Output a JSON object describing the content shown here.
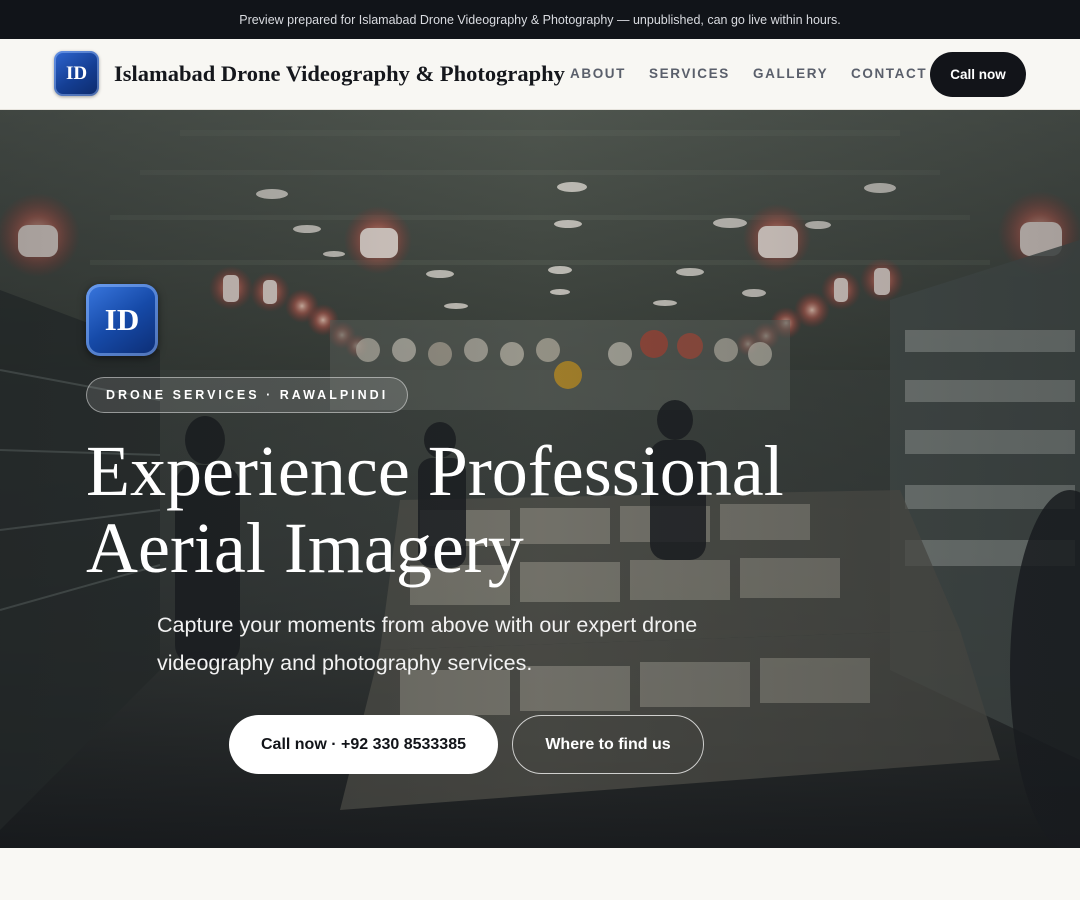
{
  "preview_bar": {
    "text": "Preview prepared for Islamabad Drone Videography & Photography — unpublished, can go live within hours."
  },
  "header": {
    "logo_initials": "ID",
    "brand_name": "Islamabad Drone Videography & Photography",
    "nav": [
      {
        "label": "ABOUT"
      },
      {
        "label": "SERVICES"
      },
      {
        "label": "GALLERY"
      },
      {
        "label": "CONTACT"
      }
    ],
    "call_button": "Call now"
  },
  "hero": {
    "logo_initials": "ID",
    "tag": "DRONE SERVICES · RAWALPINDI",
    "title_line1": "Experience Professional",
    "title_line2": "Aerial Imagery",
    "subtitle": "Capture your moments from above with our expert drone videography and photography services.",
    "primary_button": "Call now · +92 330 8533385",
    "secondary_button": "Where to find us"
  },
  "colors": {
    "dark": "#121419",
    "brand_blue": "#164aa8",
    "page_bg": "#f8f7f3"
  }
}
